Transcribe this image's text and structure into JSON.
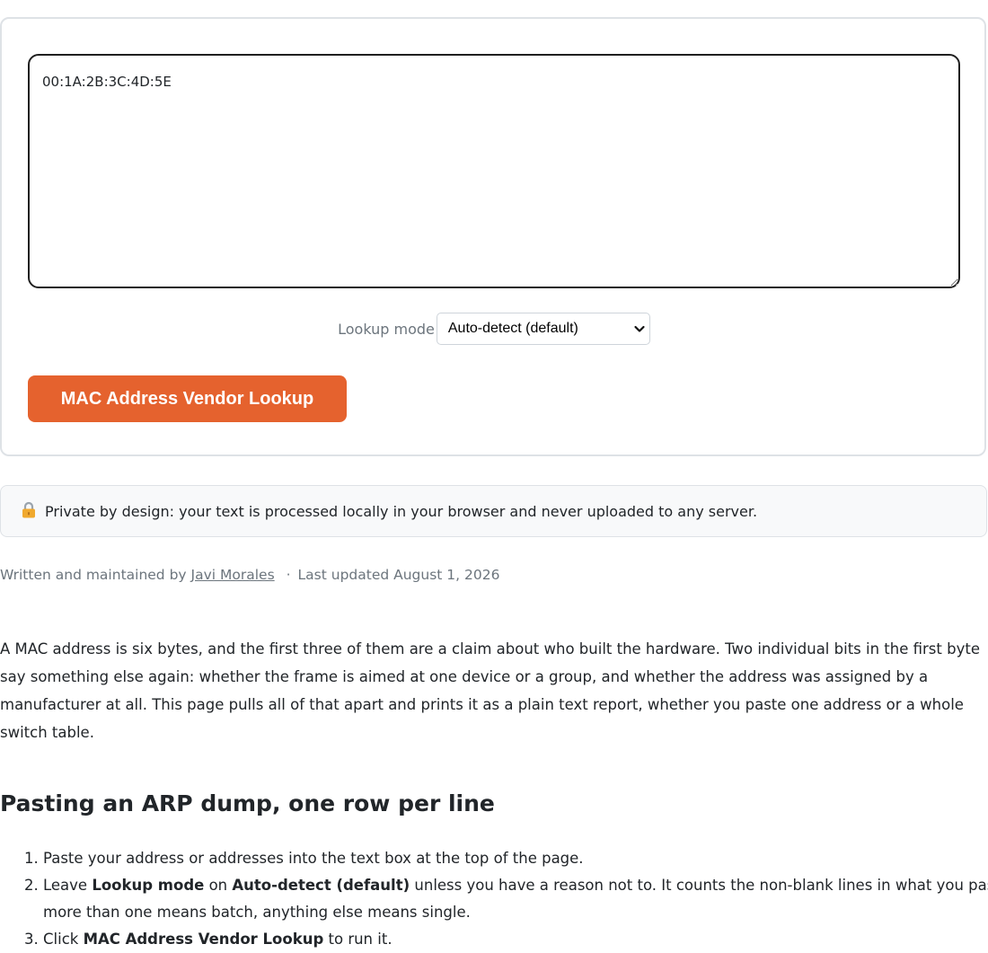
{
  "tool": {
    "input_value": "00:1A:2B:3C:4D:5E",
    "mode_label": "Lookup mode",
    "mode_selected": "Auto-detect (default)",
    "button_label": "MAC Address Vendor Lookup"
  },
  "privacy": {
    "icon": "lock-icon",
    "text": "Private by design: your text is processed locally in your browser and never uploaded to any server."
  },
  "byline": {
    "prefix": "Written and maintained by",
    "author": "Javi Morales",
    "separator": "·",
    "updated": "Last updated August 1, 2026"
  },
  "article": {
    "intro": "A MAC address is six bytes, and the first three of them are a claim about who built the hardware. Two individual bits in the first byte say something else again: whether the frame is aimed at one device or a group, and whether the address was assigned by a manufacturer at all. This page pulls all of that apart and prints it as a plain text report, whether you paste one address or a whole switch table.",
    "section_title": "Pasting an ARP dump, one row per line",
    "steps": {
      "step1": "Paste your address or addresses into the text box at the top of the page.",
      "step2_a": "Leave ",
      "step2_b": "Lookup mode",
      "step2_c": " on ",
      "step2_d": "Auto-detect (default)",
      "step2_e": " unless you have a reason not to. It counts the non-blank lines in what you pasted: more than one means batch, anything else means single.",
      "step3_a": "Click ",
      "step3_b": "MAC Address Vendor Lookup",
      "step3_c": " to run it."
    }
  },
  "colors": {
    "accent": "#e5622e",
    "muted_text": "#6c757d",
    "privacy_bg": "#f8f9fa"
  }
}
